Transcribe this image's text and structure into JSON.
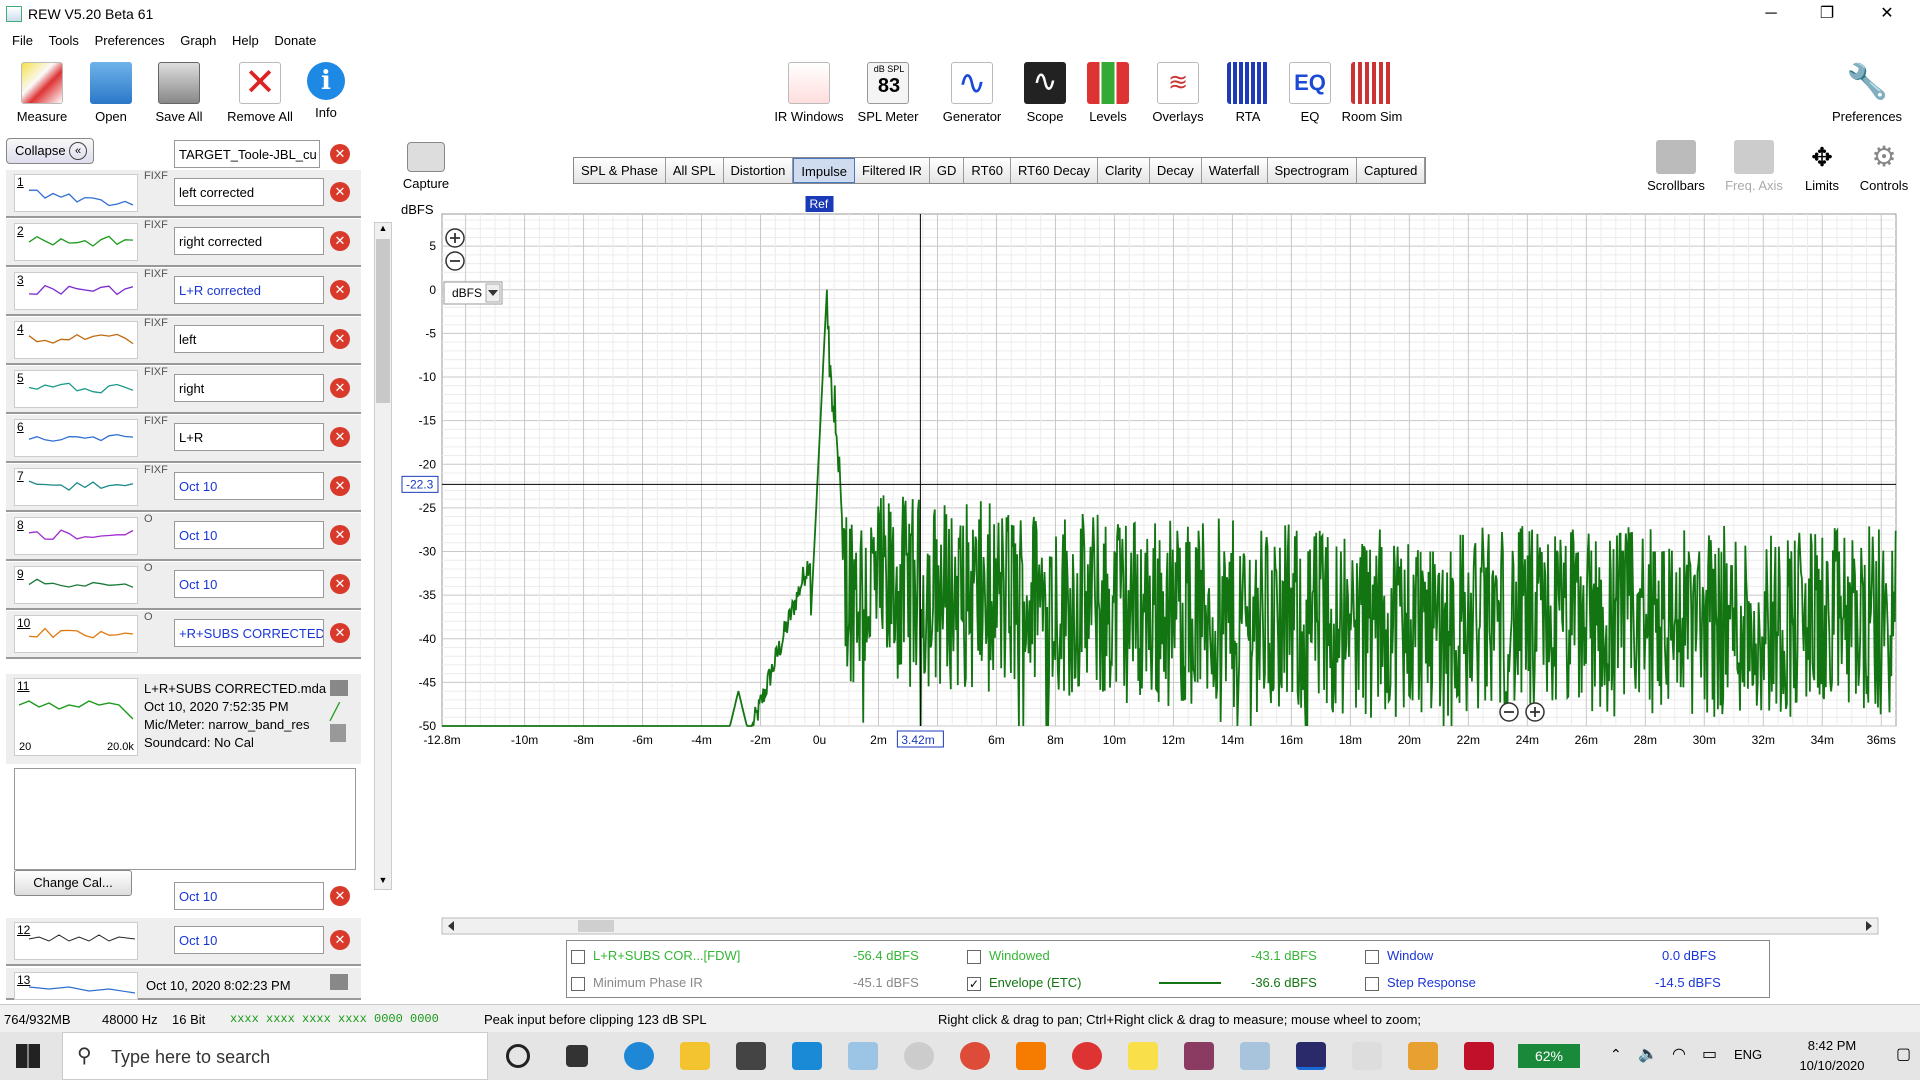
{
  "window": {
    "title": "REW V5.20 Beta 61",
    "min": "─",
    "max": "❐",
    "close": "✕"
  },
  "menu": [
    "File",
    "Tools",
    "Preferences",
    "Graph",
    "Help",
    "Donate"
  ],
  "toolbar_left": [
    "Measure",
    "Open",
    "Save All",
    "Remove All",
    "Info"
  ],
  "toolbar_center": [
    "IR Windows",
    "SPL Meter",
    "Generator",
    "Scope",
    "Levels",
    "Overlays",
    "RTA",
    "EQ",
    "Room Sim"
  ],
  "spl_meter": {
    "unit": "dB SPL",
    "value": "83"
  },
  "toolbar_right": "Preferences",
  "collapse_label": "Collapse",
  "target_name": "TARGET_Toole-JBL_cu",
  "measurements": [
    {
      "num": "1",
      "name": "left corrected",
      "flag": "FIXF",
      "color": "#2f6fd0",
      "blue": false
    },
    {
      "num": "2",
      "name": "right corrected",
      "flag": "FIXF",
      "color": "#1a9a1a",
      "blue": false
    },
    {
      "num": "3",
      "name": "L+R corrected",
      "flag": "FIXF",
      "color": "#7a2ad0",
      "blue": true
    },
    {
      "num": "4",
      "name": "left",
      "flag": "FIXF",
      "color": "#c06a10",
      "blue": false
    },
    {
      "num": "5",
      "name": "right",
      "flag": "FIXF",
      "color": "#1a9a8a",
      "blue": false
    },
    {
      "num": "6",
      "name": "L+R",
      "flag": "FIXF",
      "color": "#2f6fd0",
      "blue": false
    },
    {
      "num": "7",
      "name": "Oct 10",
      "flag": "FIXF",
      "color": "#1a8a8a",
      "blue": true
    },
    {
      "num": "8",
      "name": "Oct 10",
      "flag": "O",
      "color": "#a02ad0",
      "blue": true
    },
    {
      "num": "9",
      "name": "Oct 10",
      "flag": "O",
      "color": "#1a7a3a",
      "blue": true
    },
    {
      "num": "10",
      "name": "+R+SUBS CORRECTED",
      "flag": "O",
      "color": "#e07a10",
      "blue": true
    }
  ],
  "selected": {
    "num": "11",
    "file": "L+R+SUBS CORRECTED.mda",
    "date": "Oct 10, 2020 7:52:35 PM",
    "mic": "Mic/Meter: narrow_band_res",
    "soundcard": "Soundcard: No Cal",
    "xmin": "20",
    "xmax": "20.0k"
  },
  "change_cal": "Change Cal...",
  "extra": [
    {
      "name": "Oct 10"
    },
    {
      "num": "12",
      "name": "Oct 10"
    },
    {
      "num": "13",
      "date": "Oct 10, 2020 8:02:23 PM"
    }
  ],
  "capture": "Capture",
  "tabs": [
    "SPL & Phase",
    "All SPL",
    "Distortion",
    "Impulse",
    "Filtered IR",
    "GD",
    "RT60",
    "RT60 Decay",
    "Clarity",
    "Decay",
    "Waterfall",
    "Spectrogram",
    "Captured"
  ],
  "active_tab": "Impulse",
  "right_controls": [
    "Scrollbars",
    "Freq. Axis",
    "Limits",
    "Controls"
  ],
  "chart_data": {
    "type": "line",
    "ylabel": "dBFS",
    "y_unit_selector": "dBFS",
    "ylim": [
      -50,
      8
    ],
    "yticks": [
      5,
      0,
      -5,
      -10,
      -15,
      -20,
      -25,
      -30,
      -35,
      -40,
      -45,
      -50
    ],
    "xlim": [
      -12.8,
      36.5
    ],
    "xticks": [
      "-12.8m",
      "-10m",
      "-8m",
      "-6m",
      "-4m",
      "-2m",
      "0u",
      "2m",
      "3.42m",
      "6m",
      "8m",
      "10m",
      "12m",
      "14m",
      "16m",
      "18m",
      "20m",
      "22m",
      "24m",
      "26m",
      "28m",
      "30m",
      "32m",
      "34m",
      "36ms"
    ],
    "ref_marker": "Ref",
    "cursor": {
      "x_label": "3.42m",
      "y_label": "-22.3"
    },
    "series": [
      {
        "name": "Envelope (ETC)",
        "color": "#127512"
      }
    ]
  },
  "legend": [
    {
      "checked": false,
      "label": "L+R+SUBS COR...[FDW]",
      "value": "-56.4 dBFS",
      "color": "#35b535"
    },
    {
      "checked": false,
      "label": "Windowed",
      "value": "-43.1 dBFS",
      "color": "#35b535"
    },
    {
      "checked": false,
      "label": "Window",
      "value": "0.0 dBFS",
      "color": "#1a35d6"
    },
    {
      "checked": false,
      "label": "Minimum Phase IR",
      "value": "-45.1 dBFS",
      "color": "#888888"
    },
    {
      "checked": true,
      "label": "Envelope (ETC)",
      "value": "-36.6 dBFS",
      "color": "#127512"
    },
    {
      "checked": false,
      "label": "Step Response",
      "value": "-14.5 dBFS",
      "color": "#1a35d6"
    }
  ],
  "status": {
    "mem": "764/932MB",
    "rate": "48000 Hz",
    "bits": "16 Bit",
    "meters": "xxxx xxxx  xxxx xxxx  0000 0000",
    "peak": "Peak input before clipping 123 dB SPL",
    "hint": "Right click & drag to pan; Ctrl+Right click & drag to measure; mouse wheel to zoom;"
  },
  "taskbar": {
    "search": "Type here to search",
    "battery": "62%",
    "lang": "ENG",
    "time": "8:42 PM",
    "date": "10/10/2020"
  }
}
